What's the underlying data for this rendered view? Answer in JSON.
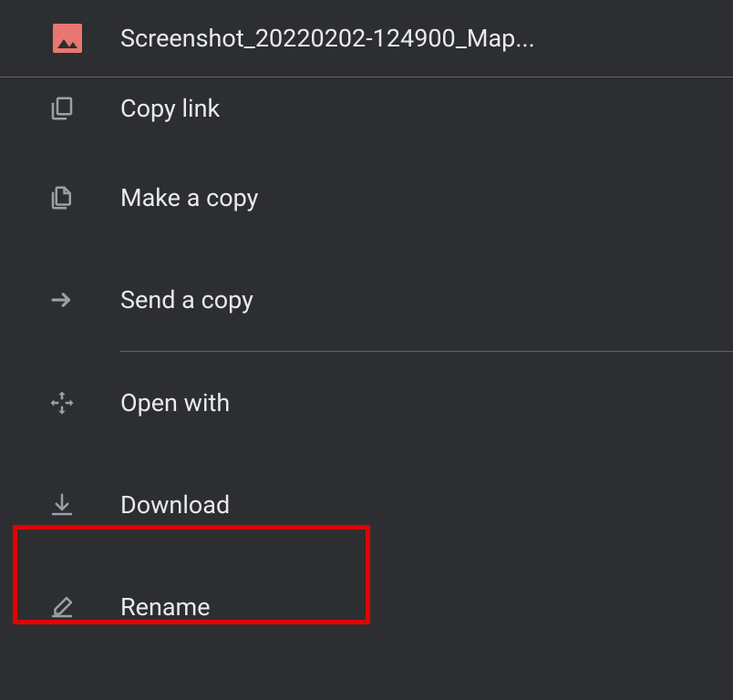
{
  "header": {
    "fileName": "Screenshot_20220202-124900_Map..."
  },
  "menu": {
    "copyLink": "Copy link",
    "makeCopy": "Make a copy",
    "sendCopy": "Send a copy",
    "openWith": "Open with",
    "download": "Download",
    "rename": "Rename"
  }
}
